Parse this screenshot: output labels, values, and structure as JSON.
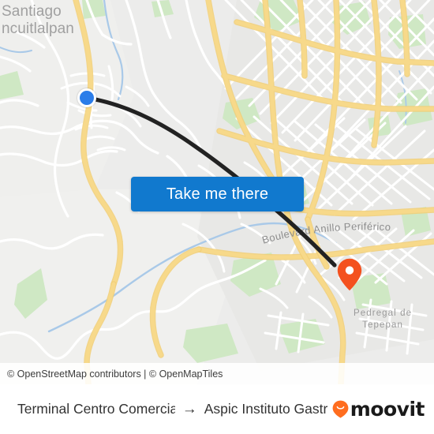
{
  "app": {
    "brand": "moovit"
  },
  "map": {
    "labels": {
      "origin_area_line1": "Santiago",
      "origin_area_line2": "ncuitlalpan",
      "road_peri": "Boulevard Anillo Periférico",
      "dest_area_line1": "Pedregal de",
      "dest_area_line2": "Tepepan"
    },
    "markers": {
      "origin_name": "origin-dot",
      "destination_name": "destination-pin"
    },
    "colors": {
      "route_line": "#222222",
      "origin_dot": "#2b7de9",
      "destination_pin": "#f4511e",
      "arterial_road": "#f7d98a",
      "minor_road": "#ffffff",
      "land": "#e9e9e7",
      "park": "#cfe8c4",
      "water": "#a5c8e8",
      "cta": "#1179ce"
    }
  },
  "cta": {
    "label": "Take me there"
  },
  "attribution": {
    "text": "© OpenStreetMap contributors | © OpenMapTiles"
  },
  "footer": {
    "origin_stop": "Terminal Centro Comercia...",
    "arrow": "→",
    "destination_stop": "Aspic Instituto Gastr...",
    "brand": "moovit"
  }
}
